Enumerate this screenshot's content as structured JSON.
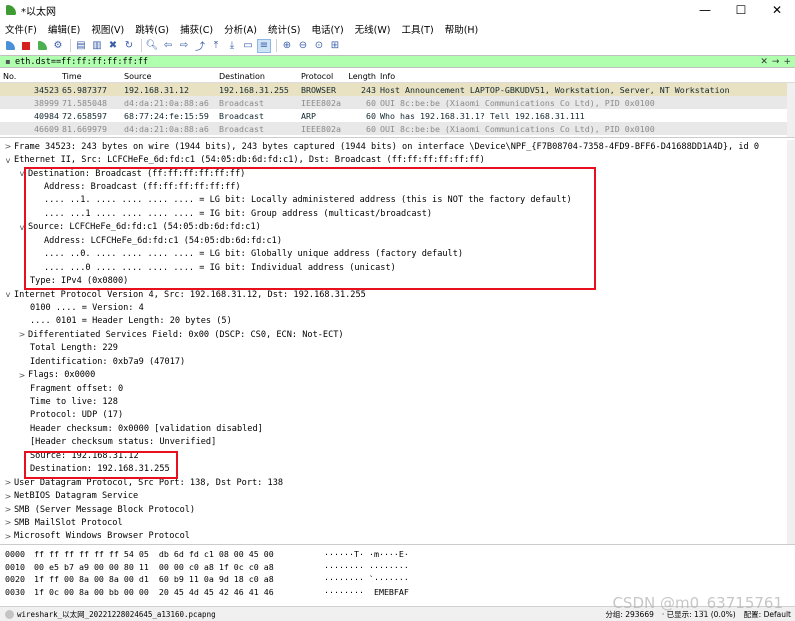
{
  "window": {
    "title": "*以太网",
    "controls": [
      "—",
      "☐",
      "✕"
    ]
  },
  "menu": [
    "文件(F)",
    "编辑(E)",
    "视图(V)",
    "跳转(G)",
    "捕获(C)",
    "分析(A)",
    "统计(S)",
    "电话(Y)",
    "无线(W)",
    "工具(T)",
    "帮助(H)"
  ],
  "filter": {
    "value": "eth.dst==ff:ff:ff:ff:ff:ff",
    "arrow": "→",
    "plus": "+"
  },
  "packet_list": {
    "headers": [
      "No.",
      "Time",
      "Source",
      "Destination",
      "Protocol",
      "Length",
      "Info"
    ],
    "rows": [
      {
        "no": "34523",
        "time": "65.987377",
        "src": "192.168.31.12",
        "dst": "192.168.31.255",
        "proto": "BROWSER",
        "len": "243",
        "info": "Host Announcement LAPTOP-GBKUDV51, Workstation, Server, NT Workstation"
      },
      {
        "no": "38999",
        "time": "71.585048",
        "src": "d4:da:21:0a:88:a6",
        "dst": "Broadcast",
        "proto": "IEEE802a",
        "len": "60",
        "info": "OUI 8c:be:be (Xiaomi Communications Co Ltd), PID 0x0100"
      },
      {
        "no": "40984",
        "time": "72.658597",
        "src": "68:77:24:fe:15:59",
        "dst": "Broadcast",
        "proto": "ARP",
        "len": "60",
        "info": "Who has 192.168.31.1? Tell 192.168.31.111"
      },
      {
        "no": "46609",
        "time": "81.669979",
        "src": "d4:da:21:0a:88:a6",
        "dst": "Broadcast",
        "proto": "IEEE802a",
        "len": "60",
        "info": "OUI 8c:be:be (Xiaomi Communications Co Ltd), PID 0x0100"
      }
    ]
  },
  "detail": [
    {
      "indent": 0,
      "arrow": ">",
      "text": "Frame 34523: 243 bytes on wire (1944 bits), 243 bytes captured (1944 bits) on interface \\Device\\NPF_{F7B08704-7358-4FD9-BFF6-D41688DD1A4D}, id 0"
    },
    {
      "indent": 0,
      "arrow": "v",
      "text": "Ethernet II, Src: LCFCHeFe_6d:fd:c1 (54:05:db:6d:fd:c1), Dst: Broadcast (ff:ff:ff:ff:ff:ff)"
    },
    {
      "indent": 1,
      "arrow": "v",
      "text": "Destination: Broadcast (ff:ff:ff:ff:ff:ff)"
    },
    {
      "indent": 2,
      "arrow": "",
      "text": "Address: Broadcast (ff:ff:ff:ff:ff:ff)"
    },
    {
      "indent": 2,
      "arrow": "",
      "text": ".... ..1. .... .... .... .... = LG bit: Locally administered address (this is NOT the factory default)"
    },
    {
      "indent": 2,
      "arrow": "",
      "text": ".... ...1 .... .... .... .... = IG bit: Group address (multicast/broadcast)"
    },
    {
      "indent": 1,
      "arrow": "v",
      "text": "Source: LCFCHeFe_6d:fd:c1 (54:05:db:6d:fd:c1)"
    },
    {
      "indent": 2,
      "arrow": "",
      "text": "Address: LCFCHeFe_6d:fd:c1 (54:05:db:6d:fd:c1)"
    },
    {
      "indent": 2,
      "arrow": "",
      "text": ".... ..0. .... .... .... .... = LG bit: Globally unique address (factory default)"
    },
    {
      "indent": 2,
      "arrow": "",
      "text": ".... ...0 .... .... .... .... = IG bit: Individual address (unicast)"
    },
    {
      "indent": 1,
      "arrow": "",
      "text": "Type: IPv4 (0x0800)"
    },
    {
      "indent": 0,
      "arrow": "v",
      "text": "Internet Protocol Version 4, Src: 192.168.31.12, Dst: 192.168.31.255"
    },
    {
      "indent": 1,
      "arrow": "",
      "text": "0100 .... = Version: 4"
    },
    {
      "indent": 1,
      "arrow": "",
      "text": ".... 0101 = Header Length: 20 bytes (5)"
    },
    {
      "indent": 1,
      "arrow": ">",
      "text": "Differentiated Services Field: 0x00 (DSCP: CS0, ECN: Not-ECT)"
    },
    {
      "indent": 1,
      "arrow": "",
      "text": "Total Length: 229"
    },
    {
      "indent": 1,
      "arrow": "",
      "text": "Identification: 0xb7a9 (47017)"
    },
    {
      "indent": 1,
      "arrow": ">",
      "text": "Flags: 0x0000"
    },
    {
      "indent": 1,
      "arrow": "",
      "text": "Fragment offset: 0"
    },
    {
      "indent": 1,
      "arrow": "",
      "text": "Time to live: 128"
    },
    {
      "indent": 1,
      "arrow": "",
      "text": "Protocol: UDP (17)"
    },
    {
      "indent": 1,
      "arrow": "",
      "text": "Header checksum: 0x0000 [validation disabled]"
    },
    {
      "indent": 1,
      "arrow": "",
      "text": "[Header checksum status: Unverified]"
    },
    {
      "indent": 1,
      "arrow": "",
      "text": "Source: 192.168.31.12"
    },
    {
      "indent": 1,
      "arrow": "",
      "text": "Destination: 192.168.31.255"
    },
    {
      "indent": 0,
      "arrow": ">",
      "text": "User Datagram Protocol, Src Port: 138, Dst Port: 138"
    },
    {
      "indent": 0,
      "arrow": ">",
      "text": "NetBIOS Datagram Service"
    },
    {
      "indent": 0,
      "arrow": ">",
      "text": "SMB (Server Message Block Protocol)"
    },
    {
      "indent": 0,
      "arrow": ">",
      "text": "SMB MailSlot Protocol"
    },
    {
      "indent": 0,
      "arrow": ">",
      "text": "Microsoft Windows Browser Protocol"
    }
  ],
  "hex": [
    {
      "off": "0000",
      "bytes": "ff ff ff ff ff ff 54 05  db 6d fd c1 08 00 45 00",
      "ascii": "······T· ·m····E·"
    },
    {
      "off": "0010",
      "bytes": "00 e5 b7 a9 00 00 80 11  00 00 c0 a8 1f 0c c0 a8",
      "ascii": "········ ········"
    },
    {
      "off": "0020",
      "bytes": "1f ff 00 8a 00 8a 00 d1  60 b9 11 0a 9d 18 c0 a8",
      "ascii": "········ `·······"
    },
    {
      "off": "0030",
      "bytes": "1f 0c 00 8a 00 bb 00 00  20 45 4d 45 42 46 41 46",
      "ascii": "········  EMEBFAF"
    }
  ],
  "status": {
    "file": "wireshark_以太网_20221228024645_a13160.pcapng",
    "packets": "分组: 293669",
    "displayed": "· 已显示: 131 (0.0%)",
    "profile": "配置: Default"
  },
  "watermark": "CSDN @m0_63715761"
}
